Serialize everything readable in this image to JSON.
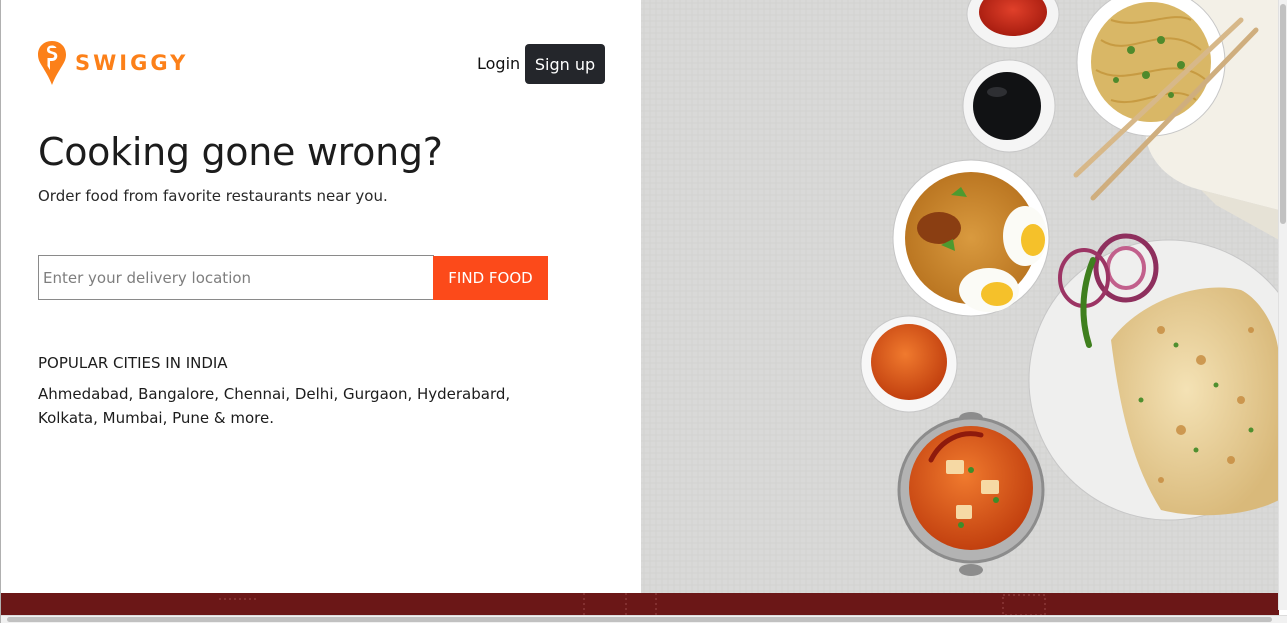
{
  "brand": {
    "name": "SWIGGY",
    "color": "#fc8019"
  },
  "nav": {
    "login_label": "Login",
    "signup_label": "Sign up"
  },
  "hero": {
    "headline": "Cooking gone wrong?",
    "subline": "Order food from favorite restaurants near you."
  },
  "search": {
    "placeholder": "Enter your delivery location",
    "value": "",
    "button_label": "FIND FOOD",
    "button_color": "#fc4a1a"
  },
  "cities": {
    "title": "POPULAR CITIES IN INDIA",
    "list": "Ahmedabad, Bangalore, Chennai, Delhi, Gurgaon, Hyderabard, Kolkata, Mumbai, Pune & more."
  },
  "colors": {
    "signup_bg": "#24262b",
    "bottom_band": "#6b1717"
  }
}
